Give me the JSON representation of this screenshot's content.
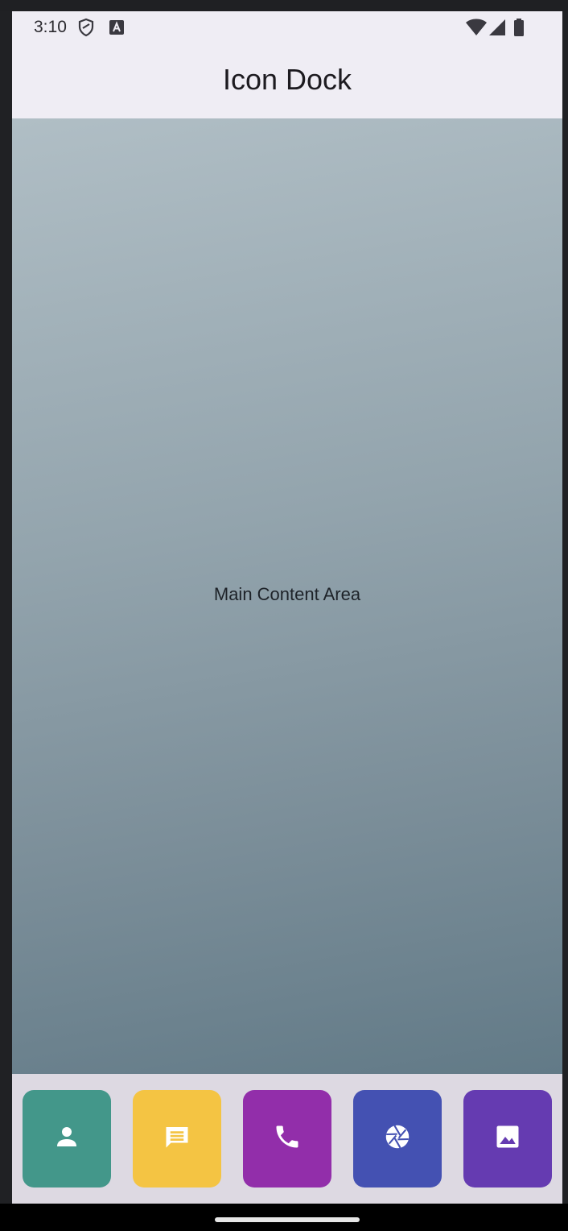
{
  "status_bar": {
    "time": "3:10",
    "icons": [
      "shield-icon",
      "keyboard-a-icon",
      "wifi-icon",
      "signal-icon",
      "battery-icon"
    ]
  },
  "app_bar": {
    "title": "Icon Dock"
  },
  "main": {
    "label": "Main Content Area",
    "gradient_colors": [
      "#b0bec5",
      "#627a87"
    ]
  },
  "dock": {
    "background": "#ddd9e2",
    "items": [
      {
        "icon": "person-icon",
        "color": "#43978a"
      },
      {
        "icon": "message-icon",
        "color": "#f4c443"
      },
      {
        "icon": "phone-icon",
        "color": "#922eaa"
      },
      {
        "icon": "camera-shutter-icon",
        "color": "#4451b2"
      },
      {
        "icon": "image-icon",
        "color": "#653bb1"
      }
    ]
  }
}
